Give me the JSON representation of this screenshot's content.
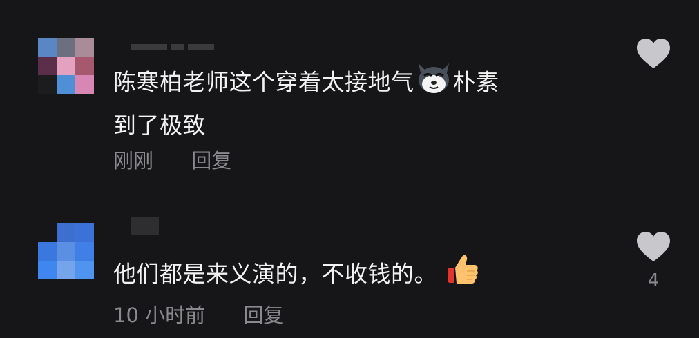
{
  "comments": [
    {
      "text_line1": "陈寒柏老师这个穿着太接地气",
      "text_line1b": "朴素",
      "text_line2": "到了极致",
      "emoji": "husky-dog-emoji",
      "time": "刚刚",
      "reply_label": "回复",
      "like_count": ""
    },
    {
      "text_line1": "他们都是来义演的，不收钱的。",
      "emoji": "thumbs-up-emoji",
      "time": "10 小时前",
      "reply_label": "回复",
      "like_count": "4"
    }
  ],
  "colors": {
    "background": "#161618",
    "text": "#f2f2f2",
    "meta": "#8a8a8e",
    "heart": "#c8c8cc"
  }
}
